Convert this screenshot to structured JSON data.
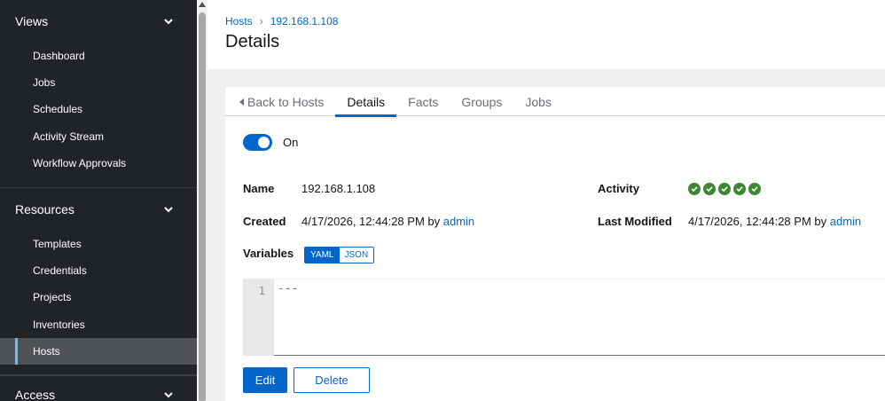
{
  "sidebar": {
    "groups": [
      {
        "title": "Views",
        "items": [
          "Dashboard",
          "Jobs",
          "Schedules",
          "Activity Stream",
          "Workflow Approvals"
        ]
      },
      {
        "title": "Resources",
        "items": [
          "Templates",
          "Credentials",
          "Projects",
          "Inventories",
          "Hosts"
        ]
      },
      {
        "title": "Access",
        "items": []
      }
    ],
    "active_item": "Hosts",
    "colors": {
      "background": "#212427",
      "active_bg": "#4f5255",
      "active_indicator": "#73bcf7"
    }
  },
  "breadcrumb": {
    "parent": "Hosts",
    "current": "192.168.1.108"
  },
  "page": {
    "title": "Details"
  },
  "tabs": {
    "back": "Back to Hosts",
    "items": [
      "Details",
      "Facts",
      "Groups",
      "Jobs"
    ],
    "active": "Details"
  },
  "toggle": {
    "label": "On",
    "enabled": true
  },
  "details": {
    "name_label": "Name",
    "name_value": "192.168.1.108",
    "created_label": "Created",
    "created_value": "4/17/2026, 12:44:28 PM by",
    "created_by": "admin",
    "activity_label": "Activity",
    "activity_count": 5,
    "last_modified_label": "Last Modified",
    "last_modified_value": "4/17/2026, 12:44:28 PM by",
    "last_modified_by": "admin",
    "variables_label": "Variables"
  },
  "variables": {
    "formats": [
      "YAML",
      "JSON"
    ],
    "active_format": "YAML",
    "line_number": "1",
    "content": "---"
  },
  "actions": {
    "edit": "Edit",
    "delete": "Delete"
  },
  "icons": {
    "chevron": "chevron-down-icon",
    "check": "check-circle-icon",
    "back": "caret-left-icon"
  },
  "accent_color": "#0066cc",
  "success_color": "#3e8635"
}
